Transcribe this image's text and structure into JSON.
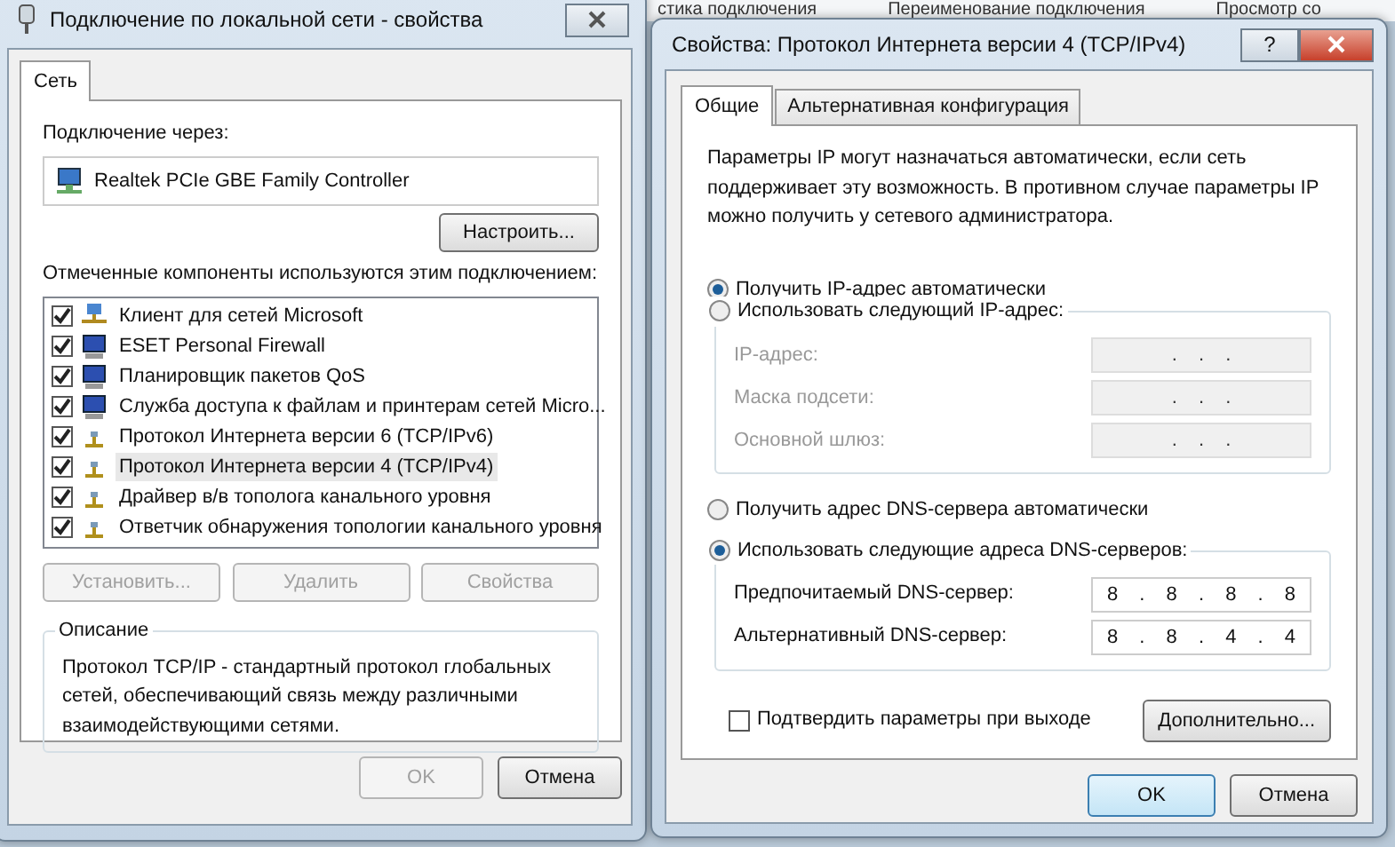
{
  "background_toolbar": [
    "стика подключения",
    "Переименование подключения",
    "Просмотр со"
  ],
  "left_window": {
    "title": "Подключение по локальной сети - свойства",
    "tabs": [
      {
        "label": "Сеть",
        "selected": true
      }
    ],
    "connect_via_label": "Подключение через:",
    "adapter": "Realtek PCIe GBE Family Controller",
    "configure_button": "Настроить...",
    "components_label": "Отмеченные компоненты используются этим подключением:",
    "components": [
      {
        "label": "Клиент для сетей Microsoft",
        "checked": true,
        "selected": false,
        "kind": "client"
      },
      {
        "label": "ESET Personal Firewall",
        "checked": true,
        "selected": false,
        "kind": "service"
      },
      {
        "label": "Планировщик пакетов QoS",
        "checked": true,
        "selected": false,
        "kind": "service"
      },
      {
        "label": "Служба доступа к файлам и принтерам сетей Micro...",
        "checked": true,
        "selected": false,
        "kind": "service"
      },
      {
        "label": "Протокол Интернета версии 6 (TCP/IPv6)",
        "checked": true,
        "selected": false,
        "kind": "protocol"
      },
      {
        "label": "Протокол Интернета версии 4 (TCP/IPv4)",
        "checked": true,
        "selected": true,
        "kind": "protocol"
      },
      {
        "label": "Драйвер в/в тополога канального уровня",
        "checked": true,
        "selected": false,
        "kind": "protocol"
      },
      {
        "label": "Ответчик обнаружения топологии канального уровня",
        "checked": true,
        "selected": false,
        "kind": "protocol"
      }
    ],
    "buttons": [
      {
        "label": "Установить...",
        "disabled": true
      },
      {
        "label": "Удалить",
        "disabled": true
      },
      {
        "label": "Свойства",
        "disabled": true
      }
    ],
    "description": {
      "title": "Описание",
      "text": "Протокол TCP/IP - стандартный протокол глобальных сетей, обеспечивающий связь между различными взаимодействующими сетями."
    },
    "footer_buttons": [
      {
        "label": "OK",
        "disabled": true
      },
      {
        "label": "Отмена",
        "disabled": false
      }
    ]
  },
  "right_window": {
    "title": "Свойства: Протокол Интернета версии 4 (TCP/IPv4)",
    "title_buttons": [
      {
        "label": "?",
        "kind": "help"
      }
    ],
    "tabs": [
      {
        "label": "Общие",
        "selected": true
      },
      {
        "label": "Альтернативная конфигурация",
        "selected": false
      }
    ],
    "intro": "Параметры IP могут назначаться автоматически, если сеть поддерживает эту возможность. В противном случае параметры IP можно получить у сетевого администратора.",
    "ip_options": [
      {
        "label": "Получить IP-адрес автоматически",
        "selected": true
      },
      {
        "label": "Использовать следующий IP-адрес:",
        "selected": false
      }
    ],
    "ip_fields": [
      {
        "label": "IP-адрес:",
        "value": ". . .",
        "disabled": true
      },
      {
        "label": "Маска подсети:",
        "value": ". . .",
        "disabled": true
      },
      {
        "label": "Основной шлюз:",
        "value": ". . .",
        "disabled": true
      }
    ],
    "dns_options": [
      {
        "label": "Получить адрес DNS-сервера автоматически",
        "selected": false
      },
      {
        "label": "Использовать следующие адреса DNS-серверов:",
        "selected": true
      }
    ],
    "dns_fields": [
      {
        "label": "Предпочитаемый DNS-сервер:",
        "value": "8 . 8 . 8 . 8",
        "disabled": false
      },
      {
        "label": "Альтернативный DNS-сервер:",
        "value": "8 . 8 . 4 . 4",
        "disabled": false
      }
    ],
    "confirm_checkbox": {
      "label": "Подтвердить параметры при выходе",
      "checked": false
    },
    "advanced_button": "Дополнительно...",
    "footer_buttons": [
      {
        "label": "OK",
        "default": true
      },
      {
        "label": "Отмена",
        "default": false
      }
    ]
  }
}
